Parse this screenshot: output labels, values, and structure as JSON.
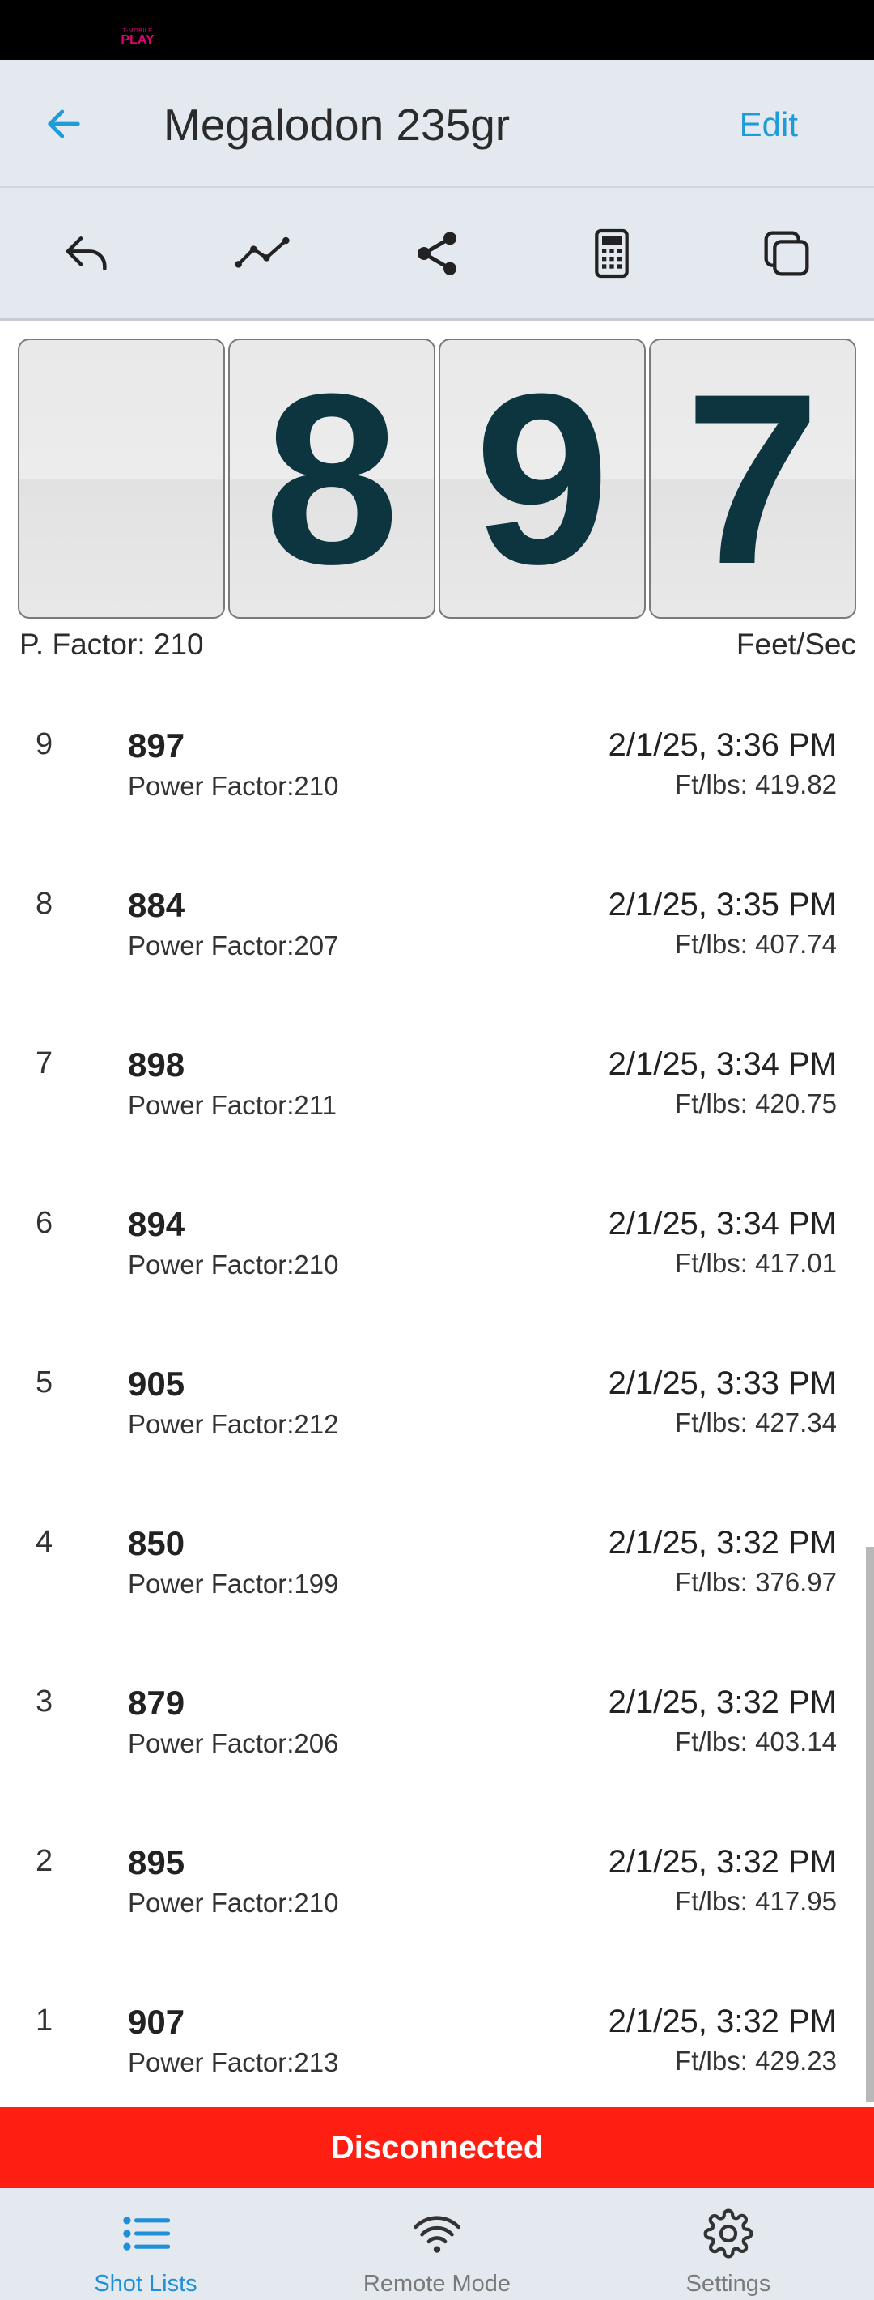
{
  "status_bar": {
    "carrier_small": "T-MOBILE",
    "carrier_big": "PLAY",
    "carrier_color": "#e20074"
  },
  "header": {
    "back_icon": "arrow-left-icon",
    "title": "Megalodon 235gr",
    "edit_label": "Edit",
    "accent_color": "#1f9bd9"
  },
  "toolbar": {
    "icons": [
      "undo-icon",
      "chart-line-icon",
      "share-icon",
      "calculator-icon",
      "copy-icon"
    ]
  },
  "display": {
    "digits": [
      "",
      "8",
      "9",
      "7"
    ],
    "power_factor_label": "P. Factor: 210",
    "units_label": "Feet/Sec"
  },
  "shots": [
    {
      "index": "9",
      "velocity": "897",
      "power_factor": "Power Factor:210",
      "time": "2/1/25, 3:36 PM",
      "energy": "Ft/lbs: 419.82"
    },
    {
      "index": "8",
      "velocity": "884",
      "power_factor": "Power Factor:207",
      "time": "2/1/25, 3:35 PM",
      "energy": "Ft/lbs: 407.74"
    },
    {
      "index": "7",
      "velocity": "898",
      "power_factor": "Power Factor:211",
      "time": "2/1/25, 3:34 PM",
      "energy": "Ft/lbs: 420.75"
    },
    {
      "index": "6",
      "velocity": "894",
      "power_factor": "Power Factor:210",
      "time": "2/1/25, 3:34 PM",
      "energy": "Ft/lbs: 417.01"
    },
    {
      "index": "5",
      "velocity": "905",
      "power_factor": "Power Factor:212",
      "time": "2/1/25, 3:33 PM",
      "energy": "Ft/lbs: 427.34"
    },
    {
      "index": "4",
      "velocity": "850",
      "power_factor": "Power Factor:199",
      "time": "2/1/25, 3:32 PM",
      "energy": "Ft/lbs: 376.97"
    },
    {
      "index": "3",
      "velocity": "879",
      "power_factor": "Power Factor:206",
      "time": "2/1/25, 3:32 PM",
      "energy": "Ft/lbs: 403.14"
    },
    {
      "index": "2",
      "velocity": "895",
      "power_factor": "Power Factor:210",
      "time": "2/1/25, 3:32 PM",
      "energy": "Ft/lbs: 417.95"
    },
    {
      "index": "1",
      "velocity": "907",
      "power_factor": "Power Factor:213",
      "time": "2/1/25, 3:32 PM",
      "energy": "Ft/lbs: 429.23"
    }
  ],
  "connection": {
    "status": "Disconnected",
    "color": "#ff1f12"
  },
  "bottom_nav": {
    "items": [
      {
        "label": "Shot Lists",
        "icon": "list-icon",
        "active": true
      },
      {
        "label": "Remote Mode",
        "icon": "wifi-icon",
        "active": false
      },
      {
        "label": "Settings",
        "icon": "gear-icon",
        "active": false
      }
    ]
  }
}
